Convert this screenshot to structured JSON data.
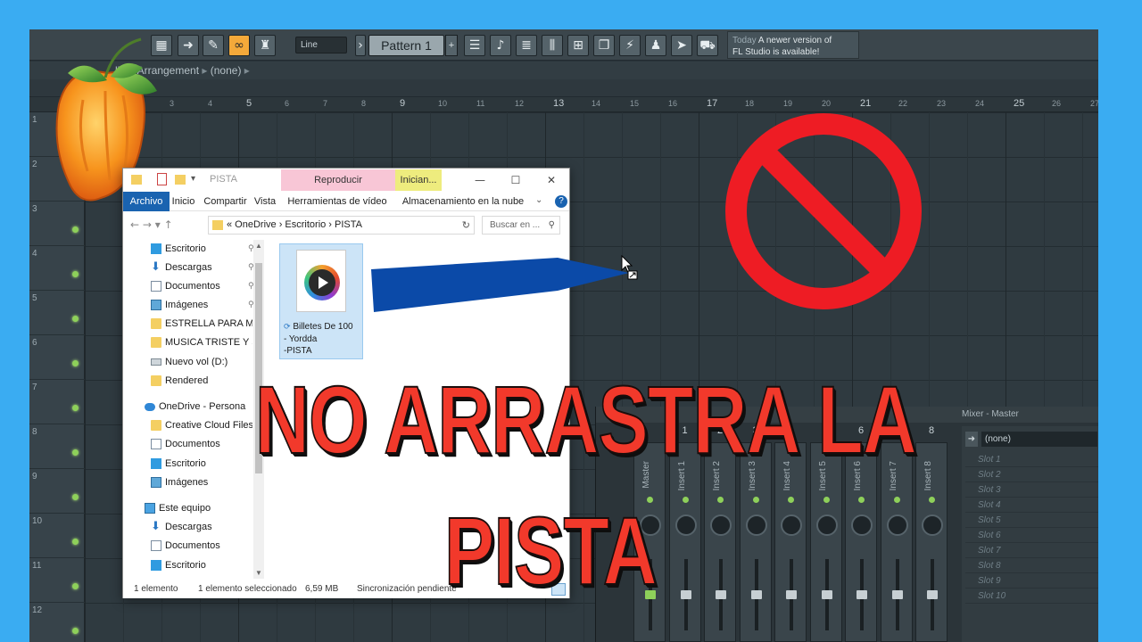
{
  "fl_studio": {
    "toolbar": {
      "line_mode": "Line",
      "pattern": "Pattern 1",
      "pattern_add": "+",
      "news_date": "Today",
      "news_line1": "A newer version of",
      "news_line2": "FL Studio is available!",
      "news_badge": "2"
    },
    "playlist_title": "list - Arrangement",
    "playlist_pattern": "(none)",
    "ruler_labels": [
      "3",
      "4",
      "5",
      "6",
      "7",
      "8",
      "9",
      "10",
      "11",
      "12",
      "13",
      "14",
      "15",
      "16",
      "17",
      "18",
      "19",
      "20",
      "21",
      "22",
      "23",
      "24",
      "25",
      "26",
      "27"
    ],
    "tracks": [
      "1",
      "2",
      "3",
      "4",
      "5",
      "6",
      "7",
      "8",
      "9",
      "10",
      "11",
      "12"
    ],
    "mixer": {
      "title": "Mixer - Master",
      "channels": [
        {
          "num": "",
          "name": "Master"
        },
        {
          "num": "1",
          "name": "Insert 1"
        },
        {
          "num": "2",
          "name": "Insert 2"
        },
        {
          "num": "3",
          "name": "Insert 3"
        },
        {
          "num": "4",
          "name": "Insert 4"
        },
        {
          "num": "5",
          "name": "Insert 5"
        },
        {
          "num": "6",
          "name": "Insert 6"
        },
        {
          "num": "7",
          "name": "Insert 7"
        },
        {
          "num": "8",
          "name": "Insert 8"
        }
      ],
      "preset": "(none)",
      "slots": [
        "Slot 1",
        "Slot 2",
        "Slot 3",
        "Slot 4",
        "Slot 5",
        "Slot 6",
        "Slot 7",
        "Slot 8",
        "Slot 9",
        "Slot 10"
      ]
    }
  },
  "explorer": {
    "title": "PISTA",
    "context_tab_play": "Reproducir",
    "context_tab_start": "Inician...",
    "ribbon_tabs": [
      "Archivo",
      "Inicio",
      "Compartir",
      "Vista",
      "Herramientas de vídeo",
      "Almacenamiento en la nube"
    ],
    "address": "« OneDrive  ›  Escritorio  ›  PISTA",
    "search_placeholder": "Buscar en ...",
    "nav_items": [
      {
        "label": "Escritorio",
        "icon": "desktop-icon",
        "pinned": true
      },
      {
        "label": "Descargas",
        "icon": "download-icon",
        "pinned": true
      },
      {
        "label": "Documentos",
        "icon": "document-icon",
        "pinned": true
      },
      {
        "label": "Imágenes",
        "icon": "pictures-icon",
        "pinned": true
      },
      {
        "label": "ESTRELLA PARA MIN",
        "icon": "folder-icon",
        "pinned": false
      },
      {
        "label": "MUSICA TRISTE Y SE",
        "icon": "folder-icon",
        "pinned": false
      },
      {
        "label": "Nuevo vol (D:)",
        "icon": "drive-icon",
        "pinned": false
      },
      {
        "label": "Rendered",
        "icon": "folder-icon",
        "pinned": false
      },
      {
        "label": "OneDrive - Personal",
        "icon": "cloud-icon",
        "pinned": false
      },
      {
        "label": "Creative Cloud Files",
        "icon": "folder-icon",
        "pinned": false
      },
      {
        "label": "Documentos",
        "icon": "document-icon",
        "pinned": false
      },
      {
        "label": "Escritorio",
        "icon": "desktop-icon",
        "pinned": false
      },
      {
        "label": "Imágenes",
        "icon": "pictures-icon",
        "pinned": false
      },
      {
        "label": "Este equipo",
        "icon": "computer-icon",
        "pinned": false
      },
      {
        "label": "Descargas",
        "icon": "download-icon",
        "pinned": false
      },
      {
        "label": "Documentos",
        "icon": "document-icon",
        "pinned": false
      },
      {
        "label": "Escritorio",
        "icon": "desktop-icon",
        "pinned": false
      }
    ],
    "file": {
      "line1": "Billetes De 100",
      "line2": "- Yordda",
      "line3": "-PISTA"
    },
    "status": {
      "count": "1 elemento",
      "selected": "1 elemento seleccionado",
      "size": "6,59 MB",
      "sync": "Sincronización pendiente"
    }
  },
  "overlay": {
    "caption_line1": "NO ARRASTRA LA",
    "caption_line2": "PISTA",
    "caption_color": "#f2392b",
    "arrow_color": "#0b4aa8",
    "no_sign_color": "#ee1c24"
  }
}
